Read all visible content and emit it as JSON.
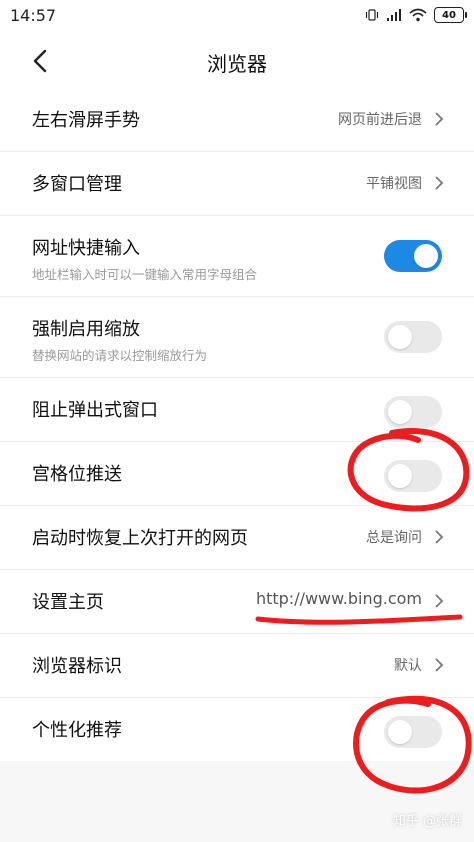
{
  "status": {
    "time": "14:57",
    "battery": "40",
    "icons": [
      "vibrate-icon",
      "signal-icon",
      "wifi-icon",
      "battery-icon"
    ]
  },
  "header": {
    "title": "浏览器",
    "back_icon": "back-arrow-icon"
  },
  "settings": [
    {
      "title": "左右滑屏手势",
      "value": "网页前进后退",
      "type": "link"
    },
    {
      "title": "多窗口管理",
      "value": "平铺视图",
      "type": "link"
    },
    {
      "title": "网址快捷输入",
      "subtitle": "地址栏输入时可以一键输入常用字母组合",
      "type": "toggle",
      "on": true
    },
    {
      "title": "强制启用缩放",
      "subtitle": "替换网站的请求以控制缩放行为",
      "type": "toggle",
      "on": false
    },
    {
      "title": "阻止弹出式窗口",
      "type": "toggle",
      "on": false
    },
    {
      "title": "宫格位推送",
      "type": "toggle",
      "on": false
    },
    {
      "title": "启动时恢复上次打开的网页",
      "value": "总是询问",
      "type": "link"
    },
    {
      "title": "设置主页",
      "value": "http://www.bing.com",
      "type": "link"
    },
    {
      "title": "浏览器标识",
      "value": "默认",
      "type": "link"
    },
    {
      "title": "个性化推荐",
      "type": "toggle",
      "on": false
    }
  ],
  "watermark": "知乎 @张群",
  "colors": {
    "accent": "#1e88e5",
    "annotation": "#ee1c1c"
  }
}
